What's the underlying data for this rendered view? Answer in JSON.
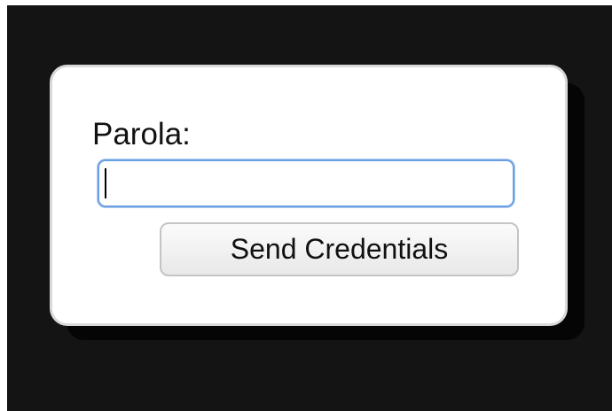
{
  "form": {
    "password_label": "Parola:",
    "password_value": "",
    "password_placeholder": "",
    "submit_label": "Send Credentials"
  }
}
